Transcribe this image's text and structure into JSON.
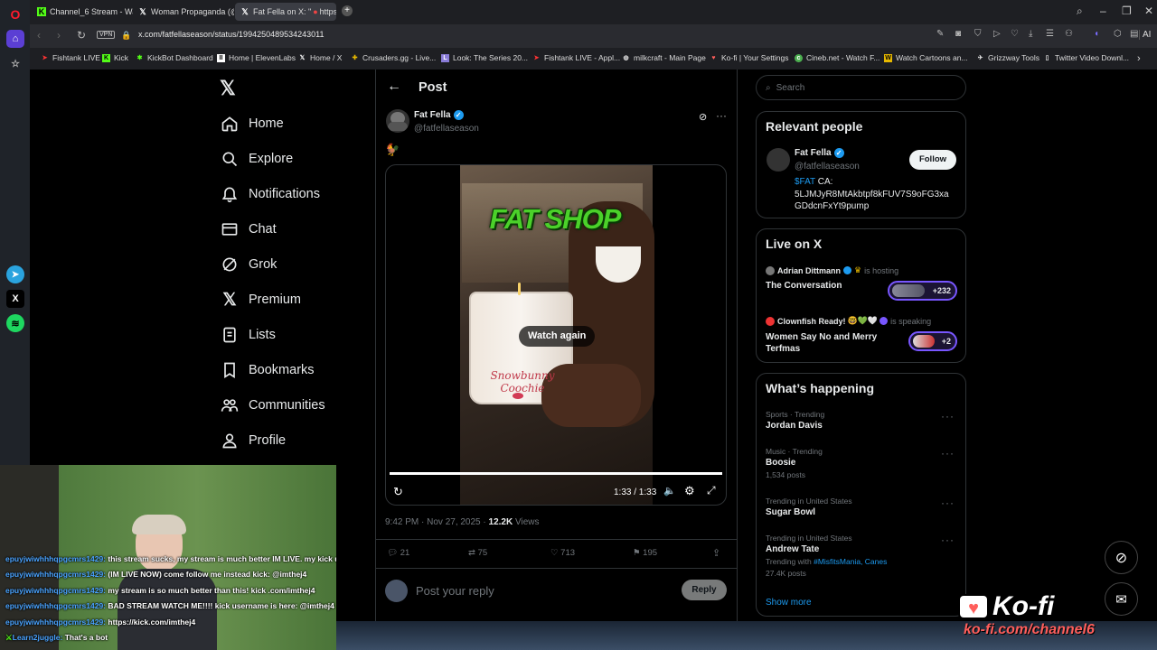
{
  "browser": {
    "tabs": [
      {
        "label": "Channel_6 Stream - Watch",
        "icon": "kick-icon"
      },
      {
        "label": "Woman Propaganda (@A",
        "icon": "x-icon"
      },
      {
        "label": "Fat Fella on X: \"",
        "extra": "https:/",
        "icon": "x-icon"
      }
    ],
    "url": "x.com/fatfellaseason/status/1994250489534243011",
    "vpn_label": "VPN",
    "ai_label": "AI",
    "bookmarks": [
      "Fishtank LIVE",
      "Kick",
      "KickBot Dashboard",
      "Home | ElevenLabs",
      "Home / X",
      "Crusaders.gg - Live...",
      "Look: The Series 20...",
      "Fishtank LIVE - Appl...",
      "milkcraft - Main Page",
      "Ko-fi | Your Settings",
      "Cineb.net - Watch F...",
      "Watch Cartoons an...",
      "Grizzway Tools",
      "Twitter Video Downl..."
    ]
  },
  "nav": {
    "items": [
      "Home",
      "Explore",
      "Notifications",
      "Chat",
      "Grok",
      "Premium",
      "Lists",
      "Bookmarks",
      "Communities",
      "Profile"
    ]
  },
  "post": {
    "header_title": "Post",
    "author_name": "Fat Fella",
    "author_handle": "@fatfellaseason",
    "emoji": "🐓",
    "video_title_art": "FAT SHOP",
    "candle_text": "Snowbunny Coochie",
    "watch_again": "Watch again",
    "video_time": "1:33 / 1:33",
    "progress": 1.0,
    "timestamp": "9:42 PM · Nov 27, 2025 ·",
    "views_count": "12.2K",
    "views_label": "Views",
    "replies": "21",
    "reposts": "75",
    "likes": "713",
    "bookmarks": "195",
    "reply_placeholder": "Post your reply",
    "reply_button": "Reply"
  },
  "search": {
    "placeholder": "Search"
  },
  "relevant": {
    "title": "Relevant people",
    "name": "Fat Fella",
    "handle": "@fatfellaseason",
    "follow": "Follow",
    "bio_ticker": "$FAT",
    "bio_rest": " CA:",
    "bio_line2": "5LJMJyR8MtAkbtpf8kFUV7S9oFG3xa",
    "bio_line3": "GDdcnFxYt9pump"
  },
  "live": {
    "title": "Live on X",
    "items": [
      {
        "host": "Adrian Dittmann",
        "status": "is hosting",
        "title": "The Conversation",
        "count": "+232"
      },
      {
        "host": "Clownfish Ready!",
        "status": "is speaking",
        "title_line1": "Women Say No and Merry",
        "title_line2": "Terfmas",
        "count": "+2"
      }
    ]
  },
  "trends": {
    "title": "What’s happening",
    "items": [
      {
        "context": "Sports · Trending",
        "name": "Jordan Davis",
        "posts": ""
      },
      {
        "context": "Music · Trending",
        "name": "Boosie",
        "posts": "1,534 posts"
      },
      {
        "context": "Trending in United States",
        "name": "Sugar Bowl",
        "posts": ""
      },
      {
        "context": "Trending in United States",
        "name": "Andrew Tate",
        "with_label": "Trending with",
        "with_tags": "#MisfitsMania, Canes",
        "posts": "27.4K posts"
      }
    ],
    "show_more": "Show more"
  },
  "chat": [
    {
      "user": "epuyjwiwhhhqpgcmrs1429:",
      "msg": "this stream sucks, my stream is much better IM LIVE. my kick username: @imthej4"
    },
    {
      "user": "epuyjwiwhhhqpgcmrs1429:",
      "msg": "(IM LIVE NOW) come follow me instead kick: @imthej4"
    },
    {
      "user": "epuyjwiwhhhqpgcmrs1429:",
      "msg": "my stream is so much better than this! kick .com/imthej4"
    },
    {
      "user": "epuyjwiwhhhqpgcmrs1429:",
      "msg": "BAD STREAM WATCH ME!!!! kick username is here: @imthej4"
    },
    {
      "user": "epuyjwiwhhhqpgcmrs1429:",
      "msg": "https://kick.com/imthej4"
    },
    {
      "user": "Learn2juggle:",
      "msg": "That's a bot"
    }
  ],
  "kofi": {
    "logo": "Ko-fi",
    "url": "ko-fi.com/channel6"
  },
  "colors": {
    "accent": "#1d9bf0",
    "bg": "#000000",
    "border": "#2f3336",
    "kofi_red": "#ff5e5b"
  }
}
